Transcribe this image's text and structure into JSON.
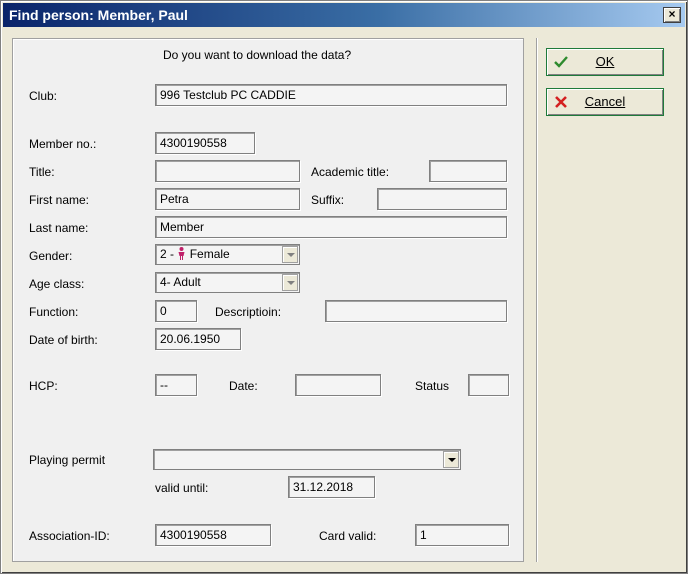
{
  "window": {
    "title": "Find person: Member, Paul",
    "close_glyph": "×"
  },
  "prompt": "Do you want to download the data?",
  "buttons": {
    "ok": "OK",
    "cancel": "Cancel"
  },
  "form": {
    "club": {
      "label": "Club:",
      "value": "996 Testclub PC CADDIE"
    },
    "member_no": {
      "label": "Member no.:",
      "value": "4300190558"
    },
    "title": {
      "label": "Title:",
      "value": ""
    },
    "academic_title": {
      "label": "Academic title:",
      "value": ""
    },
    "first_name": {
      "label": "First name:",
      "value": "Petra"
    },
    "suffix": {
      "label": "Suffix:",
      "value": ""
    },
    "last_name": {
      "label": "Last name:",
      "value": "Member"
    },
    "gender": {
      "label": "Gender:",
      "prefix": "2 - ",
      "value": "Female",
      "icon_color": "#c0206a"
    },
    "age_class": {
      "label": "Age class:",
      "value": "4- Adult"
    },
    "function": {
      "label": "Function:",
      "value": "0"
    },
    "description": {
      "label": "Descriptioin:",
      "value": ""
    },
    "date_of_birth": {
      "label": "Date of birth:",
      "value": "20.06.1950"
    },
    "hcp": {
      "label": "HCP:",
      "value": "--"
    },
    "date": {
      "label": "Date:",
      "value": ""
    },
    "status": {
      "label": "Status",
      "value": ""
    },
    "playing_permit": {
      "label": "Playing permit",
      "value": ""
    },
    "valid_until": {
      "label": "valid until:",
      "value": "31.12.2018"
    },
    "association_id": {
      "label": "Association-ID:",
      "value": "4300190558"
    },
    "card_valid": {
      "label": "Card valid:",
      "value": "1"
    }
  },
  "colors": {
    "ok_check": "#2e8b2e",
    "cancel_x": "#d42020",
    "button_border": "#1f7a3a"
  }
}
